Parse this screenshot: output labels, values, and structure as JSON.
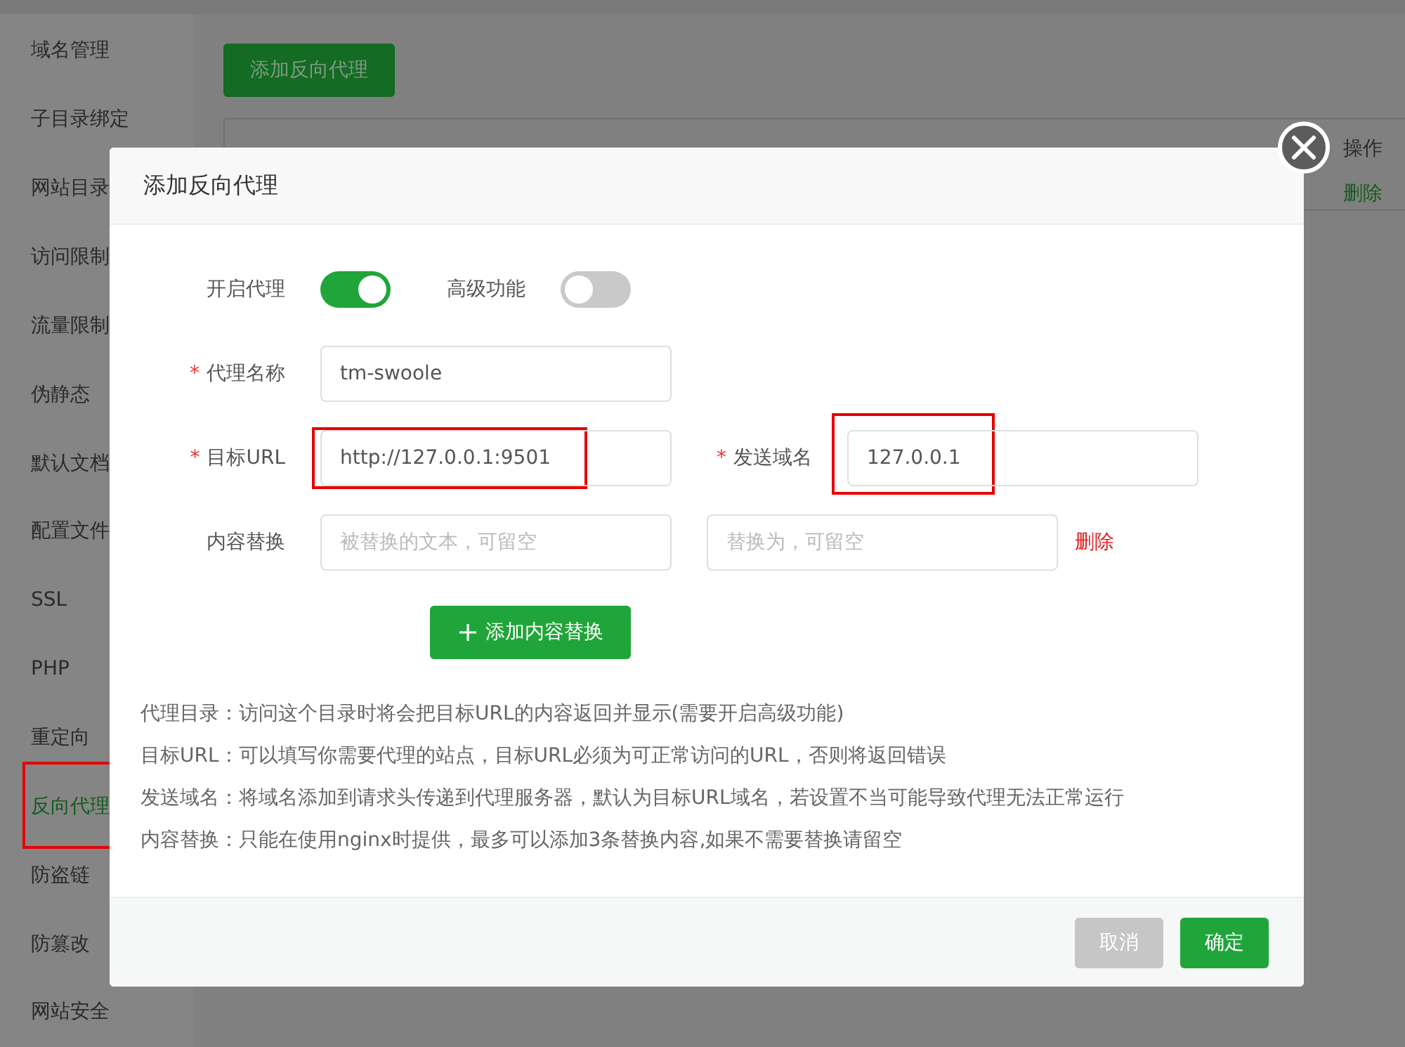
{
  "sidebar": {
    "items": [
      {
        "label": "域名管理",
        "selected": false,
        "annotated": false
      },
      {
        "label": "子目录绑定",
        "selected": false,
        "annotated": false
      },
      {
        "label": "网站目录",
        "selected": false,
        "annotated": false
      },
      {
        "label": "访问限制",
        "selected": false,
        "annotated": false
      },
      {
        "label": "流量限制",
        "selected": false,
        "annotated": false
      },
      {
        "label": "伪静态",
        "selected": false,
        "annotated": false
      },
      {
        "label": "默认文档",
        "selected": false,
        "annotated": false
      },
      {
        "label": "配置文件",
        "selected": false,
        "annotated": false
      },
      {
        "label": "SSL",
        "selected": false,
        "annotated": false
      },
      {
        "label": "PHP",
        "selected": false,
        "annotated": false
      },
      {
        "label": "重定向",
        "selected": false,
        "annotated": false
      },
      {
        "label": "反向代理",
        "selected": true,
        "annotated": true
      },
      {
        "label": "防盗链",
        "selected": false,
        "annotated": false
      },
      {
        "label": "防篡改",
        "selected": false,
        "annotated": false
      },
      {
        "label": "网站安全",
        "selected": false,
        "annotated": false
      }
    ]
  },
  "main": {
    "add_button": "添加反向代理",
    "table": {
      "header": "操作",
      "row_action": "删除"
    }
  },
  "dialog": {
    "title": "添加反向代理",
    "toggles": [
      {
        "label": "开启代理",
        "on": true
      },
      {
        "label": "高级功能",
        "on": false
      }
    ],
    "rows": [
      {
        "fields": [
          {
            "required_mark": "*",
            "label": "代理名称",
            "value": "tm-swoole"
          }
        ]
      },
      {
        "fields": [
          {
            "required_mark": "*",
            "label": "目标URL",
            "value": "http://127.0.0.1:9501",
            "annotated": true
          },
          {
            "required_mark": "*",
            "label": "发送域名",
            "value": "127.0.0.1",
            "annotated": true
          }
        ]
      },
      {
        "fields": [
          {
            "label": "内容替换",
            "placeholder": "被替换的文本，可留空"
          },
          {
            "placeholder": "替换为，可留空"
          }
        ],
        "delete_link": "删除"
      }
    ],
    "add_replace_button": "添加内容替换",
    "hints": [
      "代理目录：访问这个目录时将会把目标URL的内容返回并显示(需要开启高级功能)",
      "目标URL：可以填写你需要代理的站点，目标URL必须为可正常访问的URL，否则将返回错误",
      "发送域名：将域名添加到请求头传递到代理服务器，默认为目标URL域名，若设置不当可能导致代理无法正常运行",
      "内容替换：只能在使用nginx时提供，最多可以添加3条替换内容,如果不需要替换请留空"
    ],
    "buttons": [
      {
        "kind": "cancel",
        "label": "取消"
      },
      {
        "kind": "confirm",
        "label": "确定"
      }
    ]
  }
}
